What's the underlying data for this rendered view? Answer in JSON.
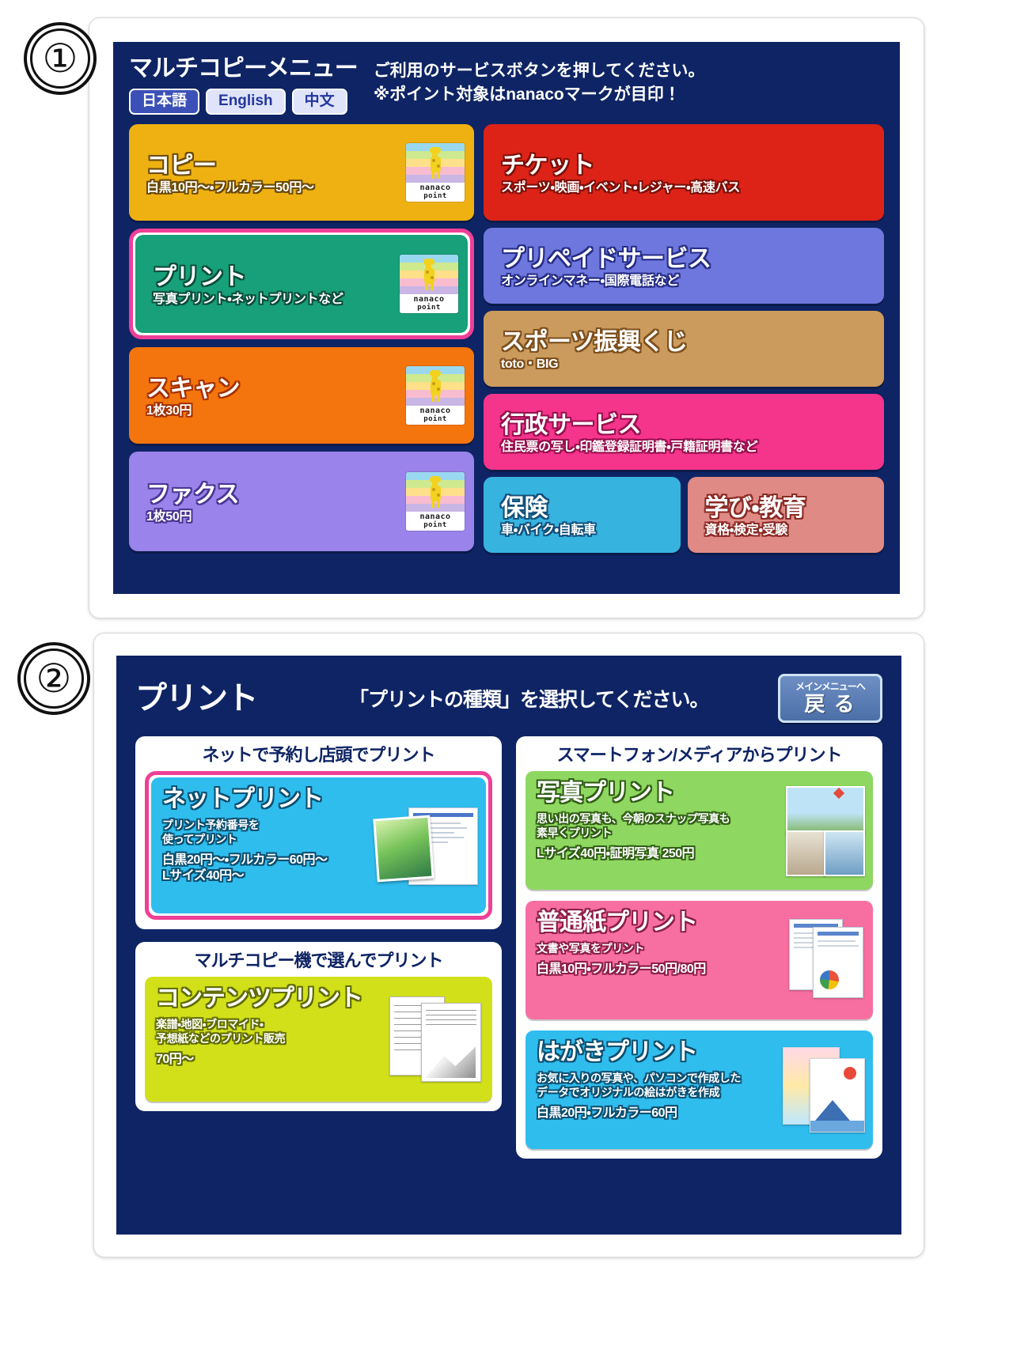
{
  "steps": {
    "one": "①",
    "two": "②"
  },
  "panel1": {
    "title": "マルチコピーメニュー",
    "instruction_line1": "ご利用のサービスボタンを押してください。",
    "instruction_line2": "※ポイント対象はnanacoマークが目印！",
    "languages": [
      {
        "label": "日本語",
        "selected": true
      },
      {
        "label": "English",
        "selected": false
      },
      {
        "label": "中文",
        "selected": false
      }
    ],
    "nanaco_badge": {
      "line1": "nanaco",
      "line2": "point"
    },
    "left_buttons": [
      {
        "title": "コピー",
        "desc": "白黒10円〜・フルカラー50円〜",
        "color": "#eeb111",
        "outline": "#6b4a06",
        "nanaco": true,
        "selected": false
      },
      {
        "title": "プリント",
        "desc": "写真プリント・ネットプリントなど",
        "color": "#17a07a",
        "outline": "#0a4c3a",
        "nanaco": true,
        "selected": true
      },
      {
        "title": "スキャン",
        "desc": "1枚30円",
        "color": "#f4750d",
        "outline": "#a33100",
        "nanaco": true,
        "selected": false
      },
      {
        "title": "ファクス",
        "desc": "1枚50円",
        "color": "#9a83ea",
        "outline": "#4a3693",
        "nanaco": true,
        "selected": false
      }
    ],
    "right_buttons": [
      {
        "title": "チケット",
        "desc": "スポーツ・映画・イベント・レジャー・高速バス",
        "color": "#dd2318",
        "outline": "#7c1009"
      },
      {
        "title": "プリペイドサービス",
        "desc": "オンラインマネー・国際電話など",
        "color": "#6d77dd",
        "outline": "#262d86"
      },
      {
        "title": "スポーツ振興くじ",
        "desc": "toto・BIG",
        "color": "#cb9b5e",
        "outline": "#7d4f1c"
      },
      {
        "title": "行政サービス",
        "desc": "住民票の写し・印鑑登録証明書・戸籍証明書など",
        "color": "#f5348b",
        "outline": "#97104e"
      }
    ],
    "bottom_buttons": [
      {
        "title": "保険",
        "desc": "車・バイク・自転車",
        "color": "#37b3e0",
        "outline": "#13507a"
      },
      {
        "title": "学び・教育",
        "desc": "資格・検定・受験",
        "color": "#e08a85",
        "outline": "#8a2a25"
      }
    ]
  },
  "panel2": {
    "title": "プリント",
    "instruction": "「プリントの種類」を選択してください。",
    "back_button": {
      "line1": "メインメニューへ",
      "line2": "戻 る"
    },
    "groups": [
      {
        "heading": "ネットで予約し店頭でプリント",
        "cards": [
          {
            "title": "ネットプリント",
            "desc": "プリント予約番号を\n使ってプリント",
            "price": "白黒20円〜・フルカラー60円〜\nLサイズ40円〜",
            "color": "#2fbdee",
            "outline": "#0c4f70",
            "selected": true,
            "thumb": "netprint-thumb"
          }
        ]
      },
      {
        "heading": "マルチコピー機で選んでプリント",
        "cards": [
          {
            "title": "コンテンツプリント",
            "desc": "楽譜・地図・ブロマイド・\n予想紙などのプリント販売",
            "price": "70円〜",
            "color": "#d2e01a",
            "outline": "#5f6b02",
            "selected": false,
            "thumb": "content-thumb"
          }
        ]
      },
      {
        "heading": "スマートフォン/メディアからプリント",
        "cards": [
          {
            "title": "写真プリント",
            "desc": "思い出の写真も、今朝のスナップ写真も\n素早くプリント",
            "price": "Lサイズ40円・証明写真 250円",
            "color": "#8ed760",
            "outline": "#2f5d14",
            "selected": false,
            "thumb": "photo-thumb"
          },
          {
            "title": "普通紙プリント",
            "desc": "文書や写真をプリント",
            "price": "白黒10円・フルカラー50円/80円",
            "color": "#f76fa0",
            "outline": "#8c1f48",
            "selected": false,
            "thumb": "paper-thumb"
          },
          {
            "title": "はがきプリント",
            "desc": "お気に入りの写真や、パソコンで作成した\nデータでオリジナルの絵はがきを作成",
            "price": "白黒20円・フルカラー60円",
            "color": "#2fbdee",
            "outline": "#0c4f70",
            "selected": false,
            "thumb": "postcard-thumb"
          }
        ]
      }
    ]
  }
}
